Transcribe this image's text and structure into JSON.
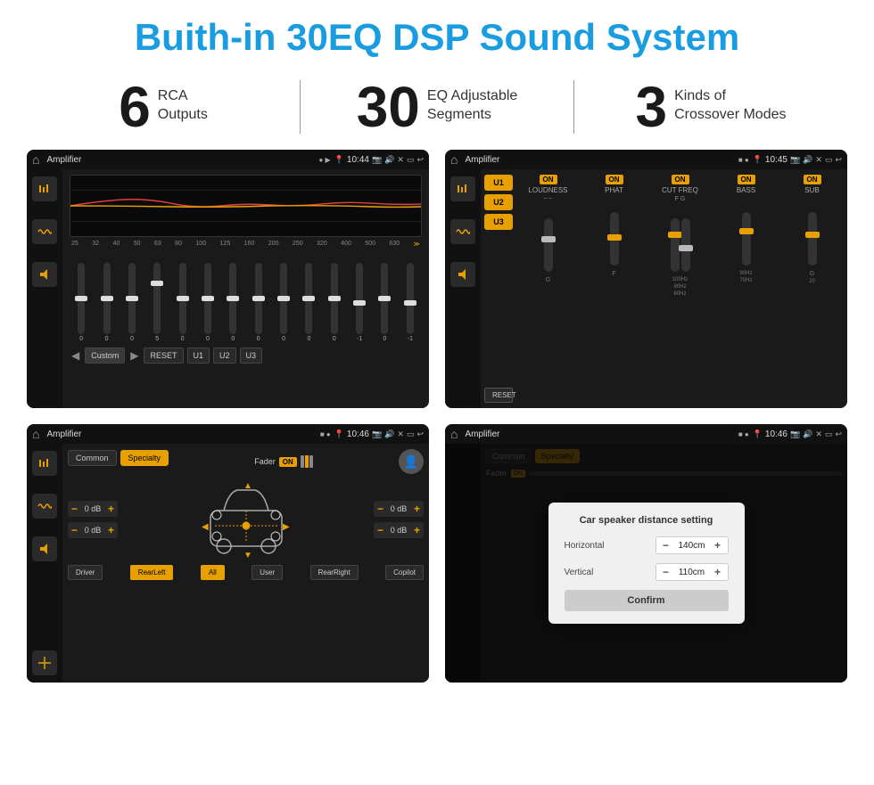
{
  "header": {
    "title": "Buith-in 30EQ DSP Sound System"
  },
  "stats": [
    {
      "number": "6",
      "label": "RCA\nOutputs",
      "label_line1": "RCA",
      "label_line2": "Outputs"
    },
    {
      "number": "30",
      "label": "EQ Adjustable\nSegments",
      "label_line1": "EQ Adjustable",
      "label_line2": "Segments"
    },
    {
      "number": "3",
      "label": "Kinds of\nCrossover Modes",
      "label_line1": "Kinds of",
      "label_line2": "Crossover Modes"
    }
  ],
  "screens": [
    {
      "id": "screen1",
      "title": "Amplifier",
      "time": "10:44",
      "type": "eq"
    },
    {
      "id": "screen2",
      "title": "Amplifier",
      "time": "10:45",
      "type": "amp"
    },
    {
      "id": "screen3",
      "title": "Amplifier",
      "time": "10:46",
      "type": "channel"
    },
    {
      "id": "screen4",
      "title": "Amplifier",
      "time": "10:46",
      "type": "dialog"
    }
  ],
  "eq": {
    "freqs": [
      "25",
      "32",
      "40",
      "50",
      "63",
      "80",
      "100",
      "125",
      "160",
      "200",
      "250",
      "320",
      "400",
      "500",
      "630"
    ],
    "values": [
      "0",
      "0",
      "0",
      "5",
      "0",
      "0",
      "0",
      "0",
      "0",
      "0",
      "0",
      "-1",
      "0",
      "-1"
    ],
    "presets": [
      "Custom",
      "RESET",
      "U1",
      "U2",
      "U3"
    ]
  },
  "amp": {
    "presets": [
      "U1",
      "U2",
      "U3"
    ],
    "controls": [
      "LOUDNESS",
      "PHAT",
      "CUT FREQ",
      "BASS",
      "SUB"
    ],
    "on_labels": [
      "ON",
      "ON",
      "ON",
      "ON",
      "ON"
    ],
    "reset": "RESET"
  },
  "channel": {
    "tabs": [
      "Common",
      "Specialty"
    ],
    "fader_label": "Fader",
    "fader_on": "ON",
    "rows": [
      {
        "db": "0 dB",
        "db2": "0 dB"
      },
      {
        "db": "0 dB",
        "db2": "0 dB"
      }
    ],
    "bottom_btns": [
      "Driver",
      "RearLeft",
      "All",
      "User",
      "RearRight",
      "Copilot"
    ]
  },
  "dialog": {
    "title": "Car speaker distance setting",
    "horizontal_label": "Horizontal",
    "horizontal_value": "140cm",
    "vertical_label": "Vertical",
    "vertical_value": "110cm",
    "confirm_label": "Confirm"
  }
}
